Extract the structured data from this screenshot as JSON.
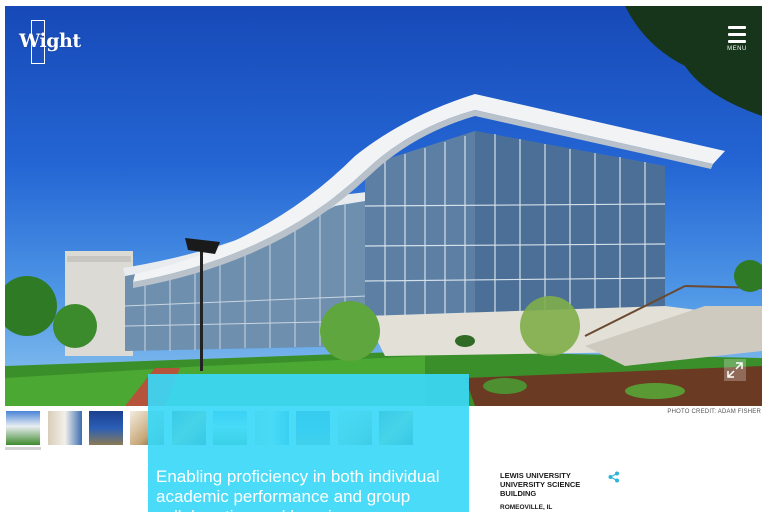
{
  "brand": {
    "logo_text": "Wight"
  },
  "nav": {
    "menu_label": "MENU"
  },
  "hero": {
    "image_subject": "Lewis University Science Building exterior with curved glass facade",
    "expand_icon": "expand-icon"
  },
  "gallery": {
    "thumbnails": [
      {
        "name": "thumb-1",
        "active": true
      },
      {
        "name": "thumb-2",
        "active": false
      },
      {
        "name": "thumb-3",
        "active": false
      },
      {
        "name": "thumb-4",
        "active": false
      },
      {
        "name": "thumb-5",
        "active": false
      },
      {
        "name": "thumb-6",
        "active": false
      },
      {
        "name": "thumb-7",
        "active": false
      },
      {
        "name": "thumb-8",
        "active": false
      },
      {
        "name": "thumb-9",
        "active": false
      },
      {
        "name": "thumb-10",
        "active": false
      },
      {
        "name": "thumb-11",
        "active": false
      }
    ]
  },
  "credit": {
    "text": "PHOTO CREDIT: ADAM FISHER"
  },
  "tagline": {
    "text": "Enabling proficiency in both individual academic performance and group collaboration and learning"
  },
  "project": {
    "title": "LEWIS UNIVERSITY UNIVERSITY SCIENCE BUILDING",
    "location": "ROMEOVILLE, IL"
  },
  "colors": {
    "accent": "#3ad8f7",
    "sky": "#2466d4"
  }
}
